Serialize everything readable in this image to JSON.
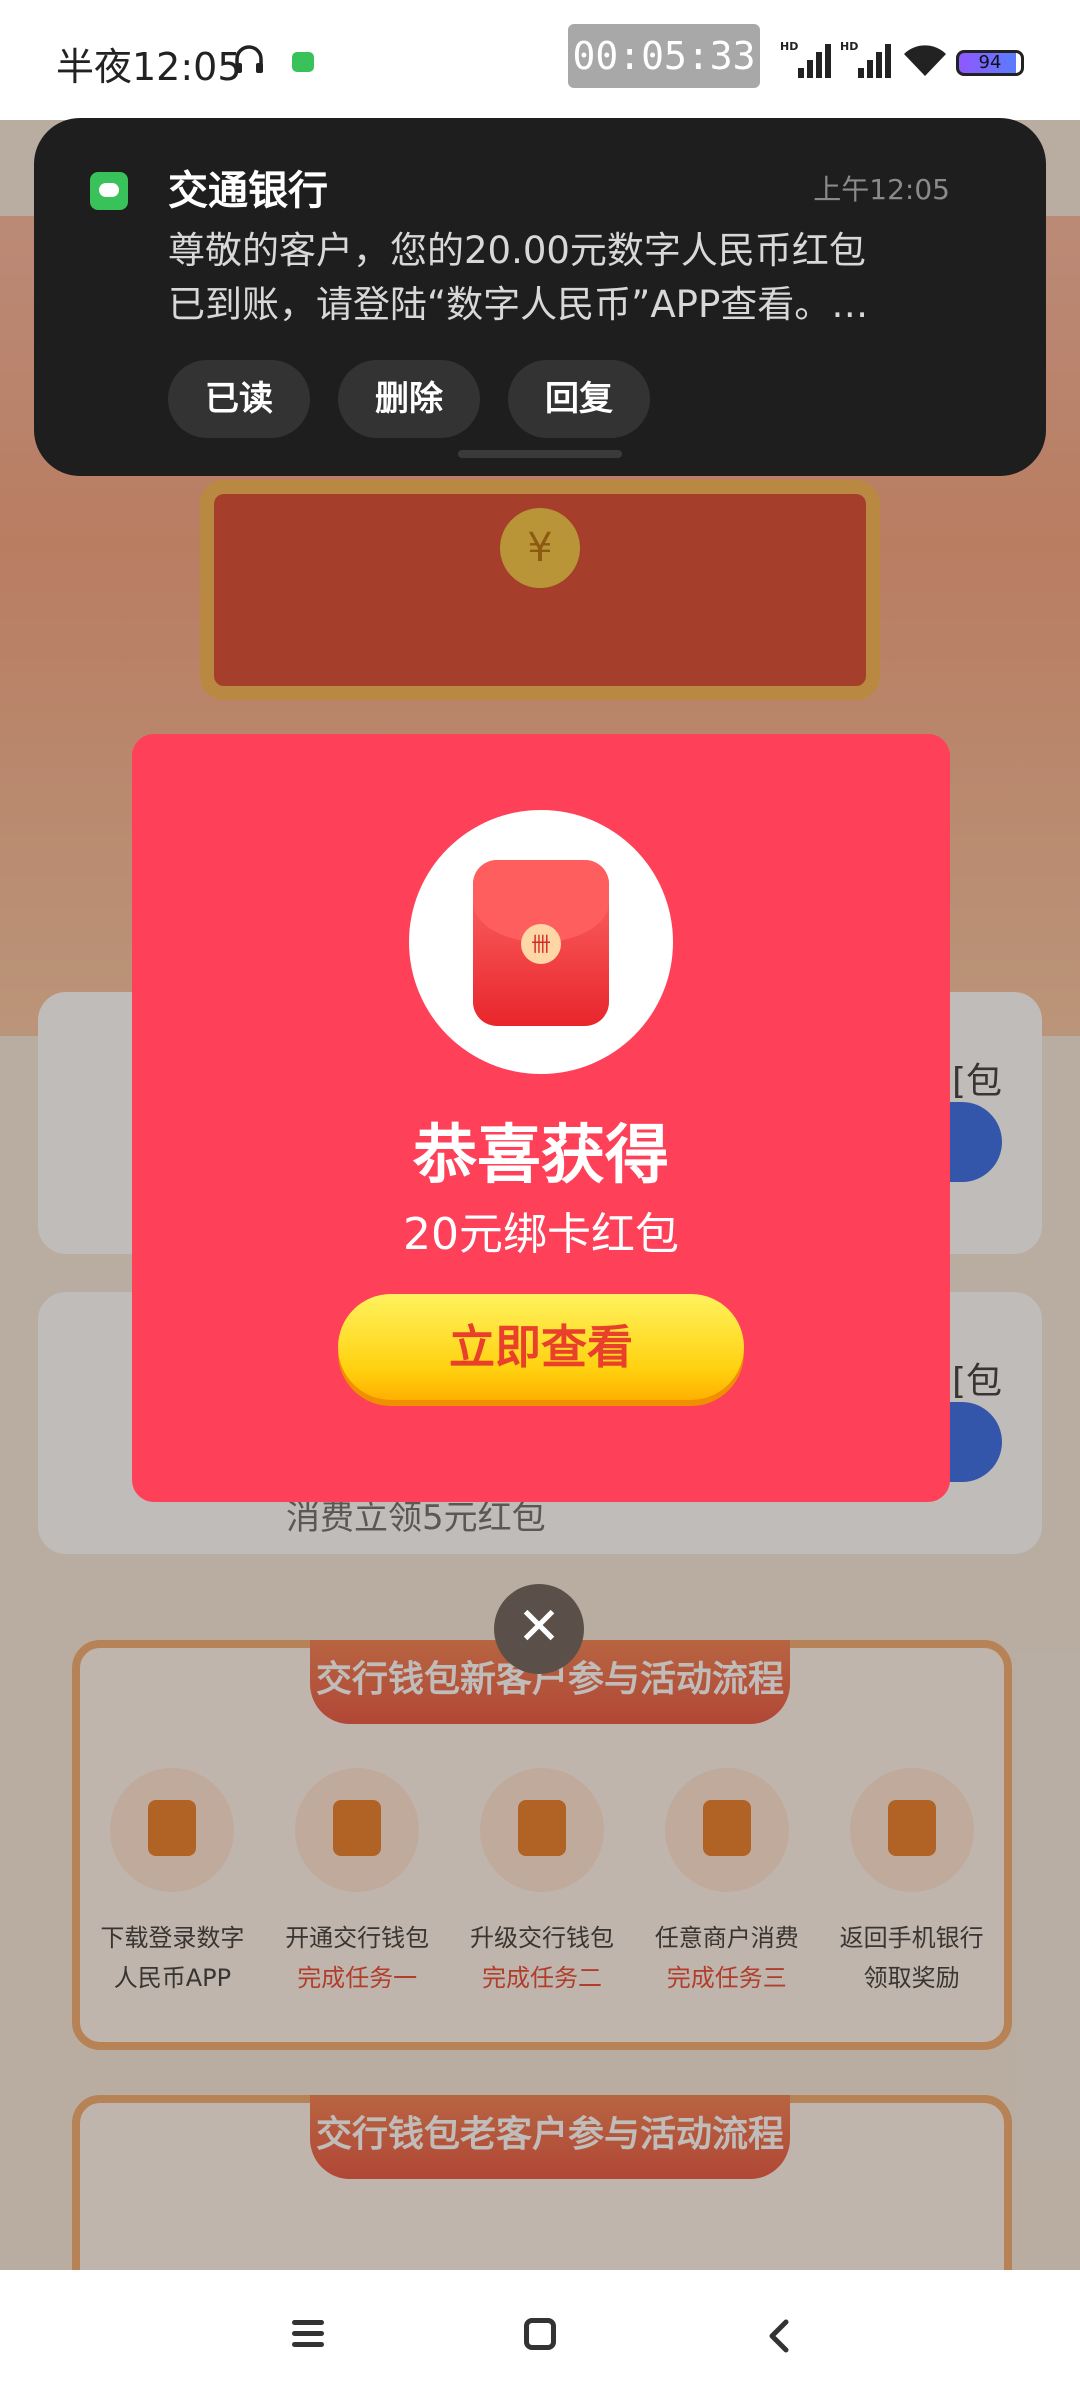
{
  "status_bar": {
    "time": "半夜12:05",
    "timer": "00:05:33",
    "battery": "94",
    "icons": [
      "headset-icon",
      "message-icon",
      "signal-icon",
      "signal-icon",
      "wifi-icon",
      "battery-icon"
    ]
  },
  "notification": {
    "app_name": "交通银行",
    "time": "上午12:05",
    "body_line1": "尊敬的客户，您的20.00元数字人民币红包",
    "body_line2": "已到账，请登陆“数字人民币”APP查看。…",
    "actions": [
      "已读",
      "删除",
      "回复"
    ]
  },
  "popup": {
    "title": "恭喜获得",
    "subtitle": "20元绑卡红包",
    "button": "立即查看",
    "envelope_seal": "卌"
  },
  "background": {
    "coin": "¥",
    "card1_tail": "[包",
    "card2_tail": "[包",
    "card2_sub": "消费立领5元红包",
    "flow_new": {
      "title": "交行钱包新客户参与活动流程",
      "steps": [
        {
          "line1": "下载登录数字",
          "line2": "人民币APP"
        },
        {
          "line1": "开通交行钱包",
          "line2": "完成任务一"
        },
        {
          "line1": "升级交行钱包",
          "line2": "完成任务二"
        },
        {
          "line1": "任意商户消费",
          "line2": "完成任务三"
        },
        {
          "line1": "返回手机银行",
          "line2": "领取奖励"
        }
      ]
    },
    "flow_old": {
      "title": "交行钱包老客户参与活动流程"
    }
  },
  "colors": {
    "popup_bg": "#fe4059",
    "button_yellow": "#ffd210",
    "notification_bg": "#1e1e1e",
    "accent_red": "#e8402a"
  }
}
